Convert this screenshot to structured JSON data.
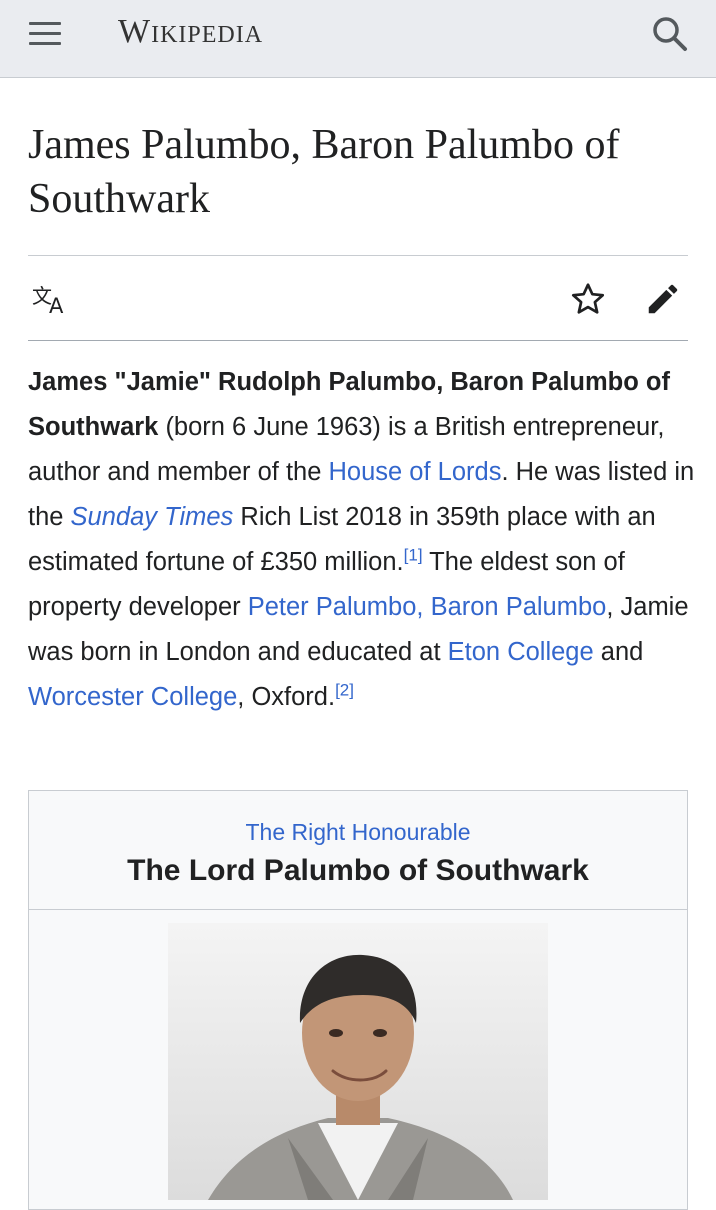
{
  "header": {
    "wordmark": "Wikipedia",
    "menu_icon": "hamburger-menu-icon",
    "search_icon": "search-icon"
  },
  "page": {
    "title": "James Palumbo, Baron Palumbo of Southwark",
    "actions": {
      "language_icon": "language-icon",
      "watch_icon": "star-icon",
      "edit_icon": "pencil-icon"
    }
  },
  "lead": {
    "bold_name": "James \"Jamie\" Rudolph Palumbo, Baron Palumbo of Southwark",
    "t1": " (born 6 June 1963) is a British entrepreneur, author and member of the ",
    "link_house_of_lords": "House of Lords",
    "t2": ". He was listed in the ",
    "link_sunday_times": "Sunday Times",
    "t3": " Rich List 2018 in 359th place with an estimated fortune of £350 million.",
    "ref1": "[1]",
    "t4": " The eldest son of property developer ",
    "link_peter_palumbo": "Peter Palumbo, Baron Palumbo",
    "t5": ", Jamie was born in London and educated at ",
    "link_eton": "Eton College",
    "t6": " and ",
    "link_worcester": "Worcester College",
    "t7": ", Oxford.",
    "ref2": "[2]"
  },
  "infobox": {
    "honorific": "The Right Honourable",
    "name": "The Lord Palumbo of Southwark"
  },
  "colors": {
    "link": "#3366cc",
    "header_bg": "#eaecf0",
    "text": "#202122"
  }
}
